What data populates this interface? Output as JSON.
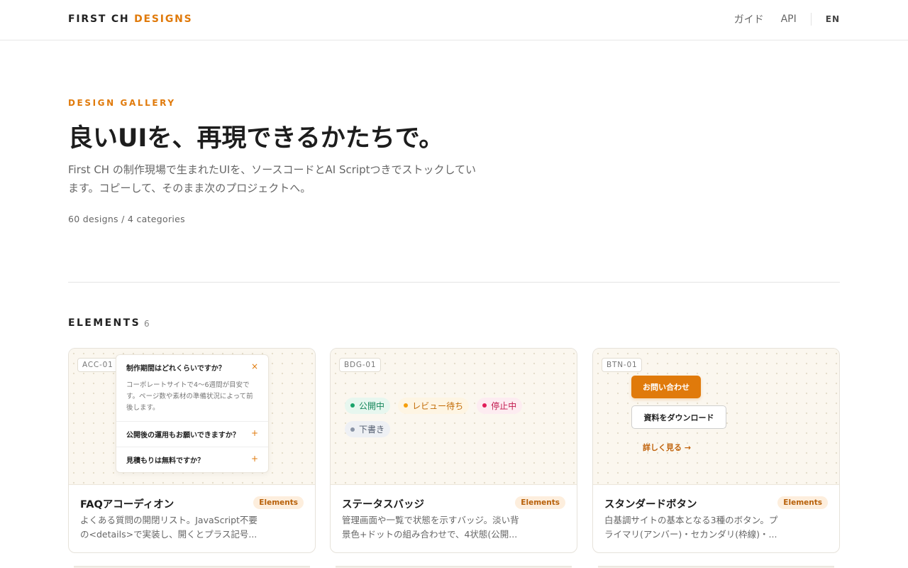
{
  "header": {
    "logo_main": "FIRST CH",
    "logo_accent": "DESIGNS",
    "nav": [
      "ガイド",
      "API"
    ],
    "lang": "EN"
  },
  "hero": {
    "eyebrow": "DESIGN GALLERY",
    "title": "良いUIを、再現できるかたちで。",
    "description": "First CH の制作現場で生まれたUIを、ソースコードとAI Scriptつきでストックしています。コピーして、そのまま次のプロジェクトへ。",
    "meta": "60 designs / 4 categories"
  },
  "section": {
    "title": "ELEMENTS",
    "count": "6"
  },
  "colors": {
    "accent": "#e07a0b",
    "badge_published": "#1aa36b",
    "badge_review": "#f59e0b",
    "badge_stopped": "#e11d5a",
    "badge_draft": "#8a94a6"
  },
  "cards": [
    {
      "code": "ACC-01",
      "title": "FAQアコーディオン",
      "tag": "Elements",
      "description": "よくある質問の開閉リスト。JavaScript不要の<details>で実装し、開くとプラス記号...",
      "preview": {
        "items": [
          {
            "q": "制作期間はどれくらいですか？",
            "mark": "×",
            "a": "コーポレートサイトで4〜6週間が目安です。ページ数や素材の準備状況によって前後します。"
          },
          {
            "q": "公開後の運用もお願いできますか？",
            "mark": "+"
          },
          {
            "q": "見積もりは無料ですか？",
            "mark": "+"
          }
        ]
      }
    },
    {
      "code": "BDG-01",
      "title": "ステータスバッジ",
      "tag": "Elements",
      "description": "管理画面や一覧で状態を示すバッジ。淡い背景色+ドットの組み合わせで、4状態(公開...",
      "preview": {
        "badges": [
          "公開中",
          "レビュー待ち",
          "停止中",
          "下書き"
        ]
      }
    },
    {
      "code": "BTN-01",
      "title": "スタンダードボタン",
      "tag": "Elements",
      "description": "白基調サイトの基本となる3種のボタン。プライマリ(アンバー)・セカンダリ(枠線)・...",
      "preview": {
        "primary": "お問い合わせ",
        "secondary": "資料をダウンロード",
        "link": "詳しく見る →"
      }
    }
  ]
}
